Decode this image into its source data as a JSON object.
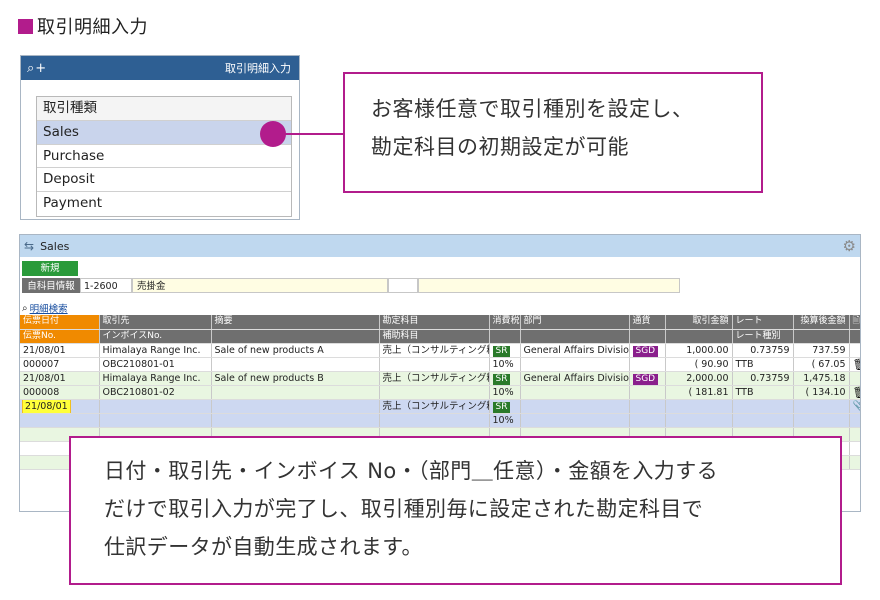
{
  "heading": {
    "title": "取引明細入力",
    "marker_color": "#b21c8c"
  },
  "panel": {
    "title": "取引明細入力",
    "icons": [
      "search-icon",
      "plus-icon"
    ],
    "list_header": "取引種類",
    "types": [
      "Sales",
      "Purchase",
      "Deposit",
      "Payment"
    ],
    "selected": "Sales"
  },
  "callout_top": {
    "lines": [
      "お客様任意で取引種別を設定し、",
      "勘定科目の初期設定が可能"
    ]
  },
  "callout_bottom": {
    "lines": [
      "日付・取引先・インボイス No・（部門＿任意）・金額を入力する",
      "だけで取引入力が完了し、取引種別毎に設定された勘定科目で",
      "仕訳データが自動生成されます。"
    ]
  },
  "grid": {
    "title": "Sales",
    "new_button": "新規",
    "account_info_label": "自科目情報",
    "account_code": "1-2600",
    "account_name": "売掛金",
    "search_link": "明細検索",
    "headers_top": [
      "伝票日付",
      "取引先",
      "摘要",
      "勘定科目",
      "消費税",
      "部門",
      "通貨",
      "取引金額",
      "レート",
      "換算後金額"
    ],
    "headers_bottom": [
      "伝票No.",
      "インボイスNo.",
      "",
      "補助科目",
      "",
      "",
      "",
      "",
      "レート種別",
      ""
    ],
    "rows": [
      {
        "date": "21/08/01",
        "no": "000007",
        "partner": "Himalaya Range Inc.",
        "invoice": "OBC210801-01",
        "memo": "Sale of new products  A",
        "account": "売上（コンサルティング料）",
        "sub_account": "",
        "tax": "SR",
        "tax_rate": "10%",
        "dept": "General Affairs Division",
        "currency": "SGD",
        "amount": "1,000.00",
        "tax_amount": "( 90.90",
        "rate": "0.73759",
        "rate_type": "TTB",
        "conv": "737.59",
        "conv_tax": "( 67.05"
      },
      {
        "date": "21/08/01",
        "no": "000008",
        "partner": "Himalaya Range Inc.",
        "invoice": "OBC210801-02",
        "memo": "Sale of new products B",
        "account": "売上（コンサルティング料）",
        "sub_account": "",
        "tax": "SR",
        "tax_rate": "10%",
        "dept": "General Affairs Division",
        "currency": "SGD",
        "amount": "2,000.00",
        "tax_amount": "( 181.81",
        "rate": "0.73759",
        "rate_type": "TTB",
        "conv": "1,475.18",
        "conv_tax": "( 134.10"
      }
    ],
    "input_row": {
      "date": "21/08/01",
      "account": "売上（コンサルティング料）",
      "tax": "SR",
      "tax_rate": "10%"
    }
  }
}
